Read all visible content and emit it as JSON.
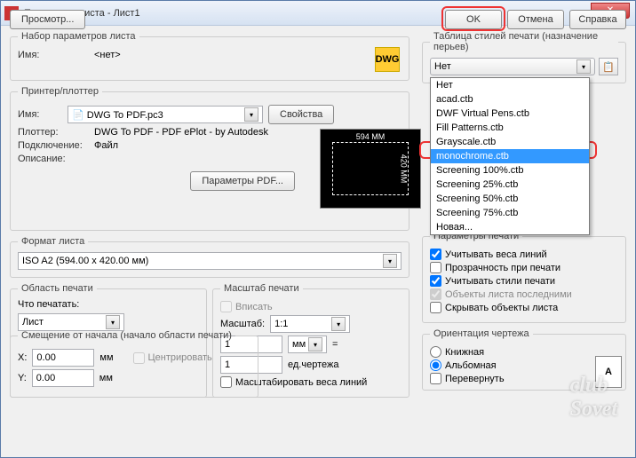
{
  "window": {
    "title": "Параметры листа - Лист1"
  },
  "pageset": {
    "legend": "Набор параметров листа",
    "name_lbl": "Имя:",
    "name_val": "<нет>",
    "dwg": "DWG"
  },
  "printer": {
    "legend": "Принтер/плоттер",
    "name_lbl": "Имя:",
    "name_val": "DWG To PDF.pc3",
    "props_btn": "Свойства",
    "plotter_lbl": "Плоттер:",
    "plotter_val": "DWG To PDF - PDF ePlot - by Autodesk",
    "conn_lbl": "Подключение:",
    "conn_val": "Файл",
    "desc_lbl": "Описание:",
    "pdf_btn": "Параметры PDF...",
    "prev_w": "594 MM",
    "prev_h": "420 MM"
  },
  "paper": {
    "legend": "Формат листа",
    "value": "ISO A2 (594.00 x 420.00 мм)"
  },
  "area": {
    "legend": "Область печати",
    "what_lbl": "Что печатать:",
    "what_val": "Лист"
  },
  "scale": {
    "legend": "Масштаб печати",
    "fit": "Вписать",
    "scale_lbl": "Масштаб:",
    "scale_val": "1:1",
    "num1": "1",
    "unit1": "мм",
    "eq": "=",
    "num2": "1",
    "unit2": "ед.чертежа",
    "scale_lw": "Масштабировать веса линий"
  },
  "offset": {
    "legend": "Смещение от начала (начало области печати)",
    "x_lbl": "X:",
    "x_val": "0.00",
    "x_unit": "мм",
    "y_lbl": "Y:",
    "y_val": "0.00",
    "y_unit": "мм",
    "center": "Центрировать"
  },
  "styles": {
    "legend": "Таблица стилей печати (назначение перьев)",
    "current": "Нет",
    "items": [
      "Нет",
      "acad.ctb",
      "DWF Virtual Pens.ctb",
      "Fill Patterns.ctb",
      "Grayscale.ctb",
      "monochrome.ctb",
      "Screening 100%.ctb",
      "Screening 25%.ctb",
      "Screening 50%.ctb",
      "Screening 75%.ctb",
      "Новая..."
    ]
  },
  "shaded": {
    "legend": "Параметры печати",
    "lw": "Учитывать веса линий",
    "trans": "Прозрачность при печати",
    "styles": "Учитывать стили печати",
    "last": "Объекты листа последними",
    "hide": "Скрывать объекты листа"
  },
  "orient": {
    "legend": "Ориентация чертежа",
    "book": "Книжная",
    "album": "Альбомная",
    "rev": "Перевернуть",
    "A": "A"
  },
  "footer": {
    "preview": "Просмотр...",
    "ok": "OK",
    "cancel": "Отмена",
    "help": "Справка"
  },
  "watermark": "club\nSovet"
}
